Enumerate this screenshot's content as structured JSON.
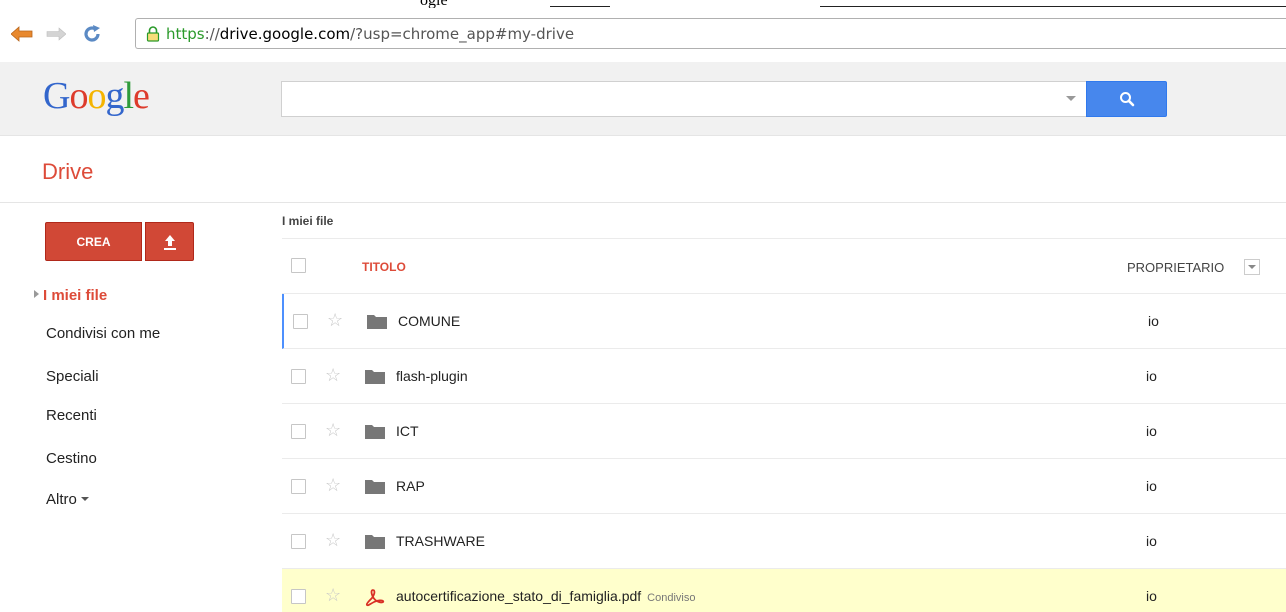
{
  "window": {
    "title_fragment": "ogle"
  },
  "browser": {
    "url_scheme": "https",
    "url_sep": "://",
    "url_host": "drive.google.com",
    "url_path": "/?usp=chrome_app#my-drive"
  },
  "header": {
    "logo_letters": [
      "G",
      "o",
      "o",
      "g",
      "l",
      "e"
    ],
    "search_placeholder": ""
  },
  "app": {
    "title": "Drive"
  },
  "sidebar": {
    "create_label": "CREA",
    "items": [
      {
        "label": "I miei file"
      },
      {
        "label": "Condivisi con me"
      },
      {
        "label": "Speciali"
      },
      {
        "label": "Recenti"
      },
      {
        "label": "Cestino"
      },
      {
        "label": "Altro"
      }
    ]
  },
  "main": {
    "breadcrumb": "I miei file",
    "columns": {
      "title": "TITOLO",
      "owner": "PROPRIETARIO"
    },
    "files": [
      {
        "name": "COMUNE",
        "type": "folder",
        "owner": "io",
        "shared_label": ""
      },
      {
        "name": "flash-plugin",
        "type": "folder",
        "owner": "io",
        "shared_label": ""
      },
      {
        "name": "ICT",
        "type": "folder",
        "owner": "io",
        "shared_label": ""
      },
      {
        "name": "RAP",
        "type": "folder",
        "owner": "io",
        "shared_label": ""
      },
      {
        "name": "TRASHWARE",
        "type": "folder",
        "owner": "io",
        "shared_label": ""
      },
      {
        "name": "autocertificazione_stato_di_famiglia.pdf",
        "type": "pdf",
        "owner": "io",
        "shared_label": "Condiviso"
      }
    ]
  },
  "colors": {
    "accent_red": "#dd4b39",
    "search_blue": "#4787ed",
    "selected_row": "#ffffcc",
    "focus_blue": "#4d90fe"
  }
}
